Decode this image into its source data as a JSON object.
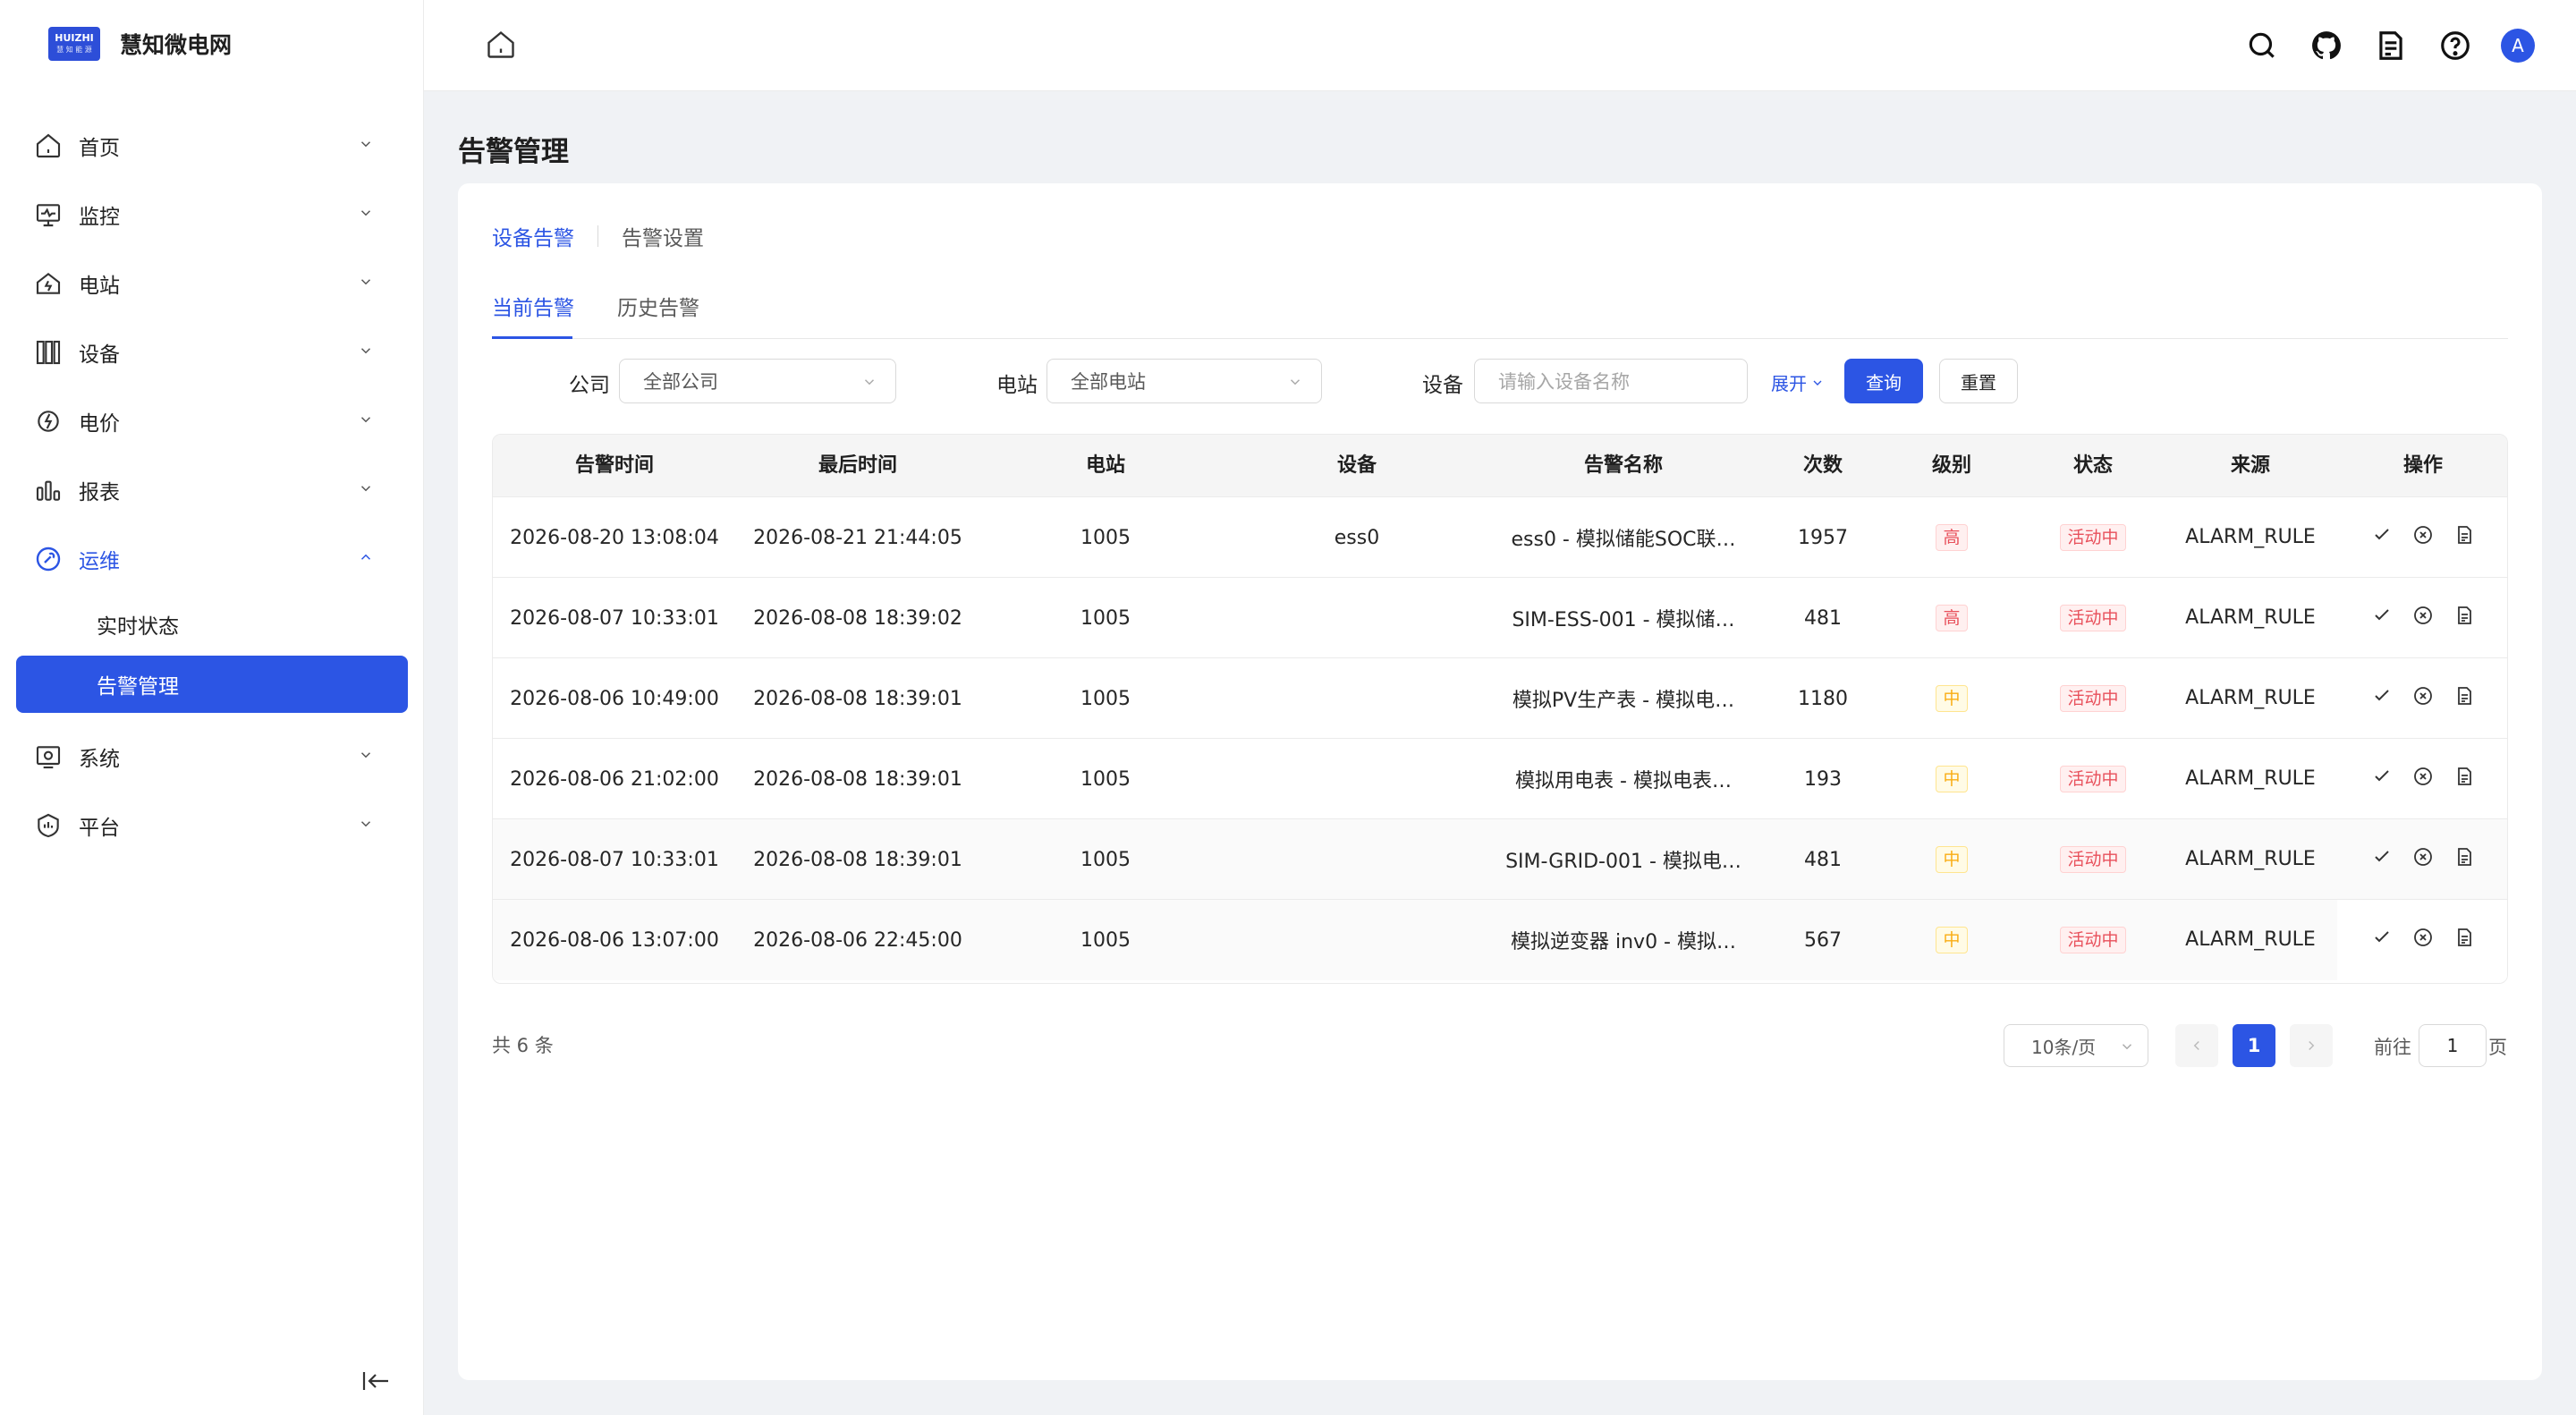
{
  "app": {
    "name": "慧知微电网",
    "logo_text": "HUIZHI",
    "logo_sub": "慧 知 能 源"
  },
  "sidebar": {
    "items": [
      {
        "label": "首页",
        "icon": "home-icon"
      },
      {
        "label": "监控",
        "icon": "monitor-icon"
      },
      {
        "label": "电站",
        "icon": "station-icon"
      },
      {
        "label": "设备",
        "icon": "device-icon"
      },
      {
        "label": "电价",
        "icon": "price-icon"
      },
      {
        "label": "报表",
        "icon": "report-icon"
      },
      {
        "label": "运维",
        "icon": "maintenance-icon"
      },
      {
        "label": "系统",
        "icon": "system-icon"
      },
      {
        "label": "平台",
        "icon": "platform-icon"
      }
    ],
    "submenu": [
      "实时状态",
      "告警管理"
    ]
  },
  "header": {
    "icons": [
      "home-icon",
      "search-icon",
      "github-icon",
      "docs-icon",
      "help-icon"
    ],
    "avatar": "A"
  },
  "page": {
    "title": "告警管理",
    "tabs_primary": [
      "设备告警",
      "告警设置"
    ],
    "tabs_secondary": [
      "当前告警",
      "历史告警"
    ]
  },
  "filters": {
    "company_label": "公司",
    "company_value": "全部公司",
    "station_label": "电站",
    "station_value": "全部电站",
    "device_label": "设备",
    "device_placeholder": "请输入设备名称",
    "expand_label": "展开",
    "query_button": "查询",
    "reset_button": "重置"
  },
  "table": {
    "columns": [
      "告警时间",
      "最后时间",
      "电站",
      "设备",
      "告警名称",
      "次数",
      "级别",
      "状态",
      "来源",
      "操作"
    ],
    "rows": [
      {
        "time": "2026-08-20 13:08:04",
        "last": "2026-08-21 21:44:05",
        "station": "1005",
        "device": "ess0",
        "name": "ess0 - 模拟储能SOC联…",
        "count": "1957",
        "level": "高",
        "status": "活动中",
        "source": "ALARM_RULE"
      },
      {
        "time": "2026-08-07 10:33:01",
        "last": "2026-08-08 18:39:02",
        "station": "1005",
        "device": "",
        "name": "SIM-ESS-001 - 模拟储…",
        "count": "481",
        "level": "高",
        "status": "活动中",
        "source": "ALARM_RULE"
      },
      {
        "time": "2026-08-06 10:49:00",
        "last": "2026-08-08 18:39:01",
        "station": "1005",
        "device": "",
        "name": "模拟PV生产表 - 模拟电…",
        "count": "1180",
        "level": "中",
        "status": "活动中",
        "source": "ALARM_RULE"
      },
      {
        "time": "2026-08-06 21:02:00",
        "last": "2026-08-08 18:39:01",
        "station": "1005",
        "device": "",
        "name": "模拟用电表 - 模拟电表…",
        "count": "193",
        "level": "中",
        "status": "活动中",
        "source": "ALARM_RULE"
      },
      {
        "time": "2026-08-07 10:33:01",
        "last": "2026-08-08 18:39:01",
        "station": "1005",
        "device": "",
        "name": "SIM-GRID-001 - 模拟电…",
        "count": "481",
        "level": "中",
        "status": "活动中",
        "source": "ALARM_RULE"
      },
      {
        "time": "2026-08-06 13:07:00",
        "last": "2026-08-06 22:45:00",
        "station": "1005",
        "device": "",
        "name": "模拟逆变器 inv0 - 模拟…",
        "count": "567",
        "level": "中",
        "status": "活动中",
        "source": "ALARM_RULE"
      }
    ]
  },
  "pagination": {
    "total": "共 6 条",
    "page_size": "10条/页",
    "current_page": "1",
    "goto_prefix": "前往",
    "goto_value": "1",
    "goto_suffix": "页"
  },
  "colors": {
    "primary": "#2c55e4",
    "danger": "#e8505b",
    "warning": "#faad14"
  }
}
